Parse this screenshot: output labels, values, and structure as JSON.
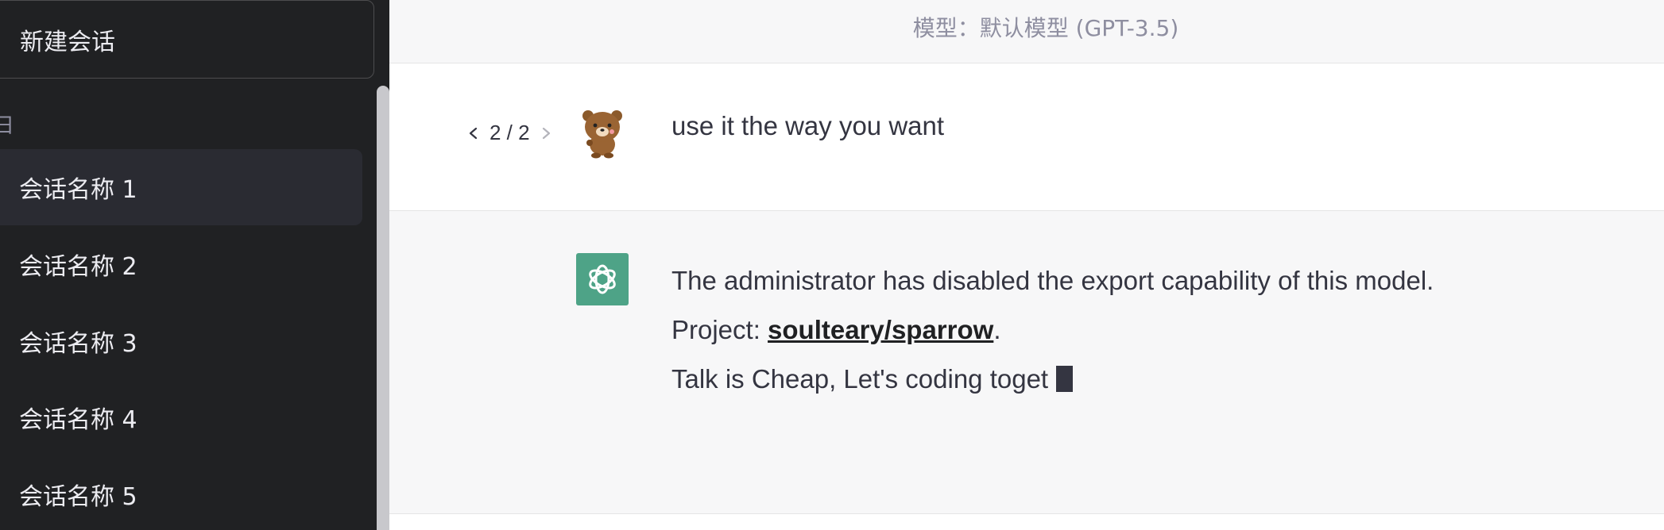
{
  "sidebar": {
    "new_chat_label": "新建会话",
    "section_label": "日",
    "conversations": [
      {
        "label": "会话名称 1"
      },
      {
        "label": "会话名称 2"
      },
      {
        "label": "会话名称 3"
      },
      {
        "label": "会话名称 4"
      },
      {
        "label": "会话名称 5"
      }
    ]
  },
  "main": {
    "model_label": "模型：默认模型 (GPT-3.5)",
    "user_message": {
      "pager": "2 / 2",
      "text": "use it the way you want",
      "avatar_icon": "bear-avatar-icon"
    },
    "assistant_message": {
      "avatar_icon": "openai-logo-icon",
      "line1": "The administrator has disabled the export capability of this model.",
      "project_prefix": "Project: ",
      "project_link": "soulteary/sparrow",
      "project_suffix": ".",
      "line3": "Talk is Cheap, Let's coding toget"
    }
  },
  "colors": {
    "sidebar_bg": "#202123",
    "accent_bot": "#4ea387",
    "text": "#343541"
  }
}
